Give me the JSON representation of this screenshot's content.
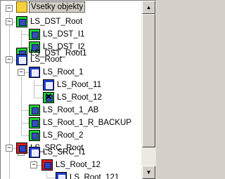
{
  "tree": {
    "rows": [
      {
        "label": "Vsetky objekty",
        "icon": "root-folder-icon",
        "selected": true
      },
      {
        "label": "LS_DST_Root",
        "icon": "green-node-icon"
      },
      {
        "label": "LS_DST_I1",
        "icon": "green-node-icon"
      },
      {
        "label": "LS_DST_I2",
        "icon": "green-node-icon"
      },
      {
        "label": "LS_DST_Root1",
        "icon": "green-node-icon"
      },
      {
        "label": "LS_Root",
        "icon": "blue-node-icon"
      },
      {
        "label": "LS_Root_1",
        "icon": "blue-node-icon"
      },
      {
        "label": "LS_Root_11",
        "icon": "blue-node-icon"
      },
      {
        "label": "LS_Root_12",
        "icon": "green-node-icon"
      },
      {
        "label": "LS_Root_1_AB",
        "icon": "green-node-icon"
      },
      {
        "label": "LS_Root_1_R_BACKUP",
        "icon": "green-node-icon"
      },
      {
        "label": "LS_Root_2",
        "icon": "green-node-icon"
      },
      {
        "label": "LS_SRC_Root",
        "icon": "red-node-icon"
      },
      {
        "label": "LS_SRC_I1",
        "icon": "blue-node-icon"
      },
      {
        "label": "LS_Root_12",
        "icon": "red-node-icon"
      },
      {
        "label": "LS_Root_121",
        "icon": "blue-node-icon"
      }
    ]
  },
  "scrollbar": {
    "up_icon": "scroll-up-arrow-icon",
    "down_icon": "scroll-down-arrow-icon"
  }
}
